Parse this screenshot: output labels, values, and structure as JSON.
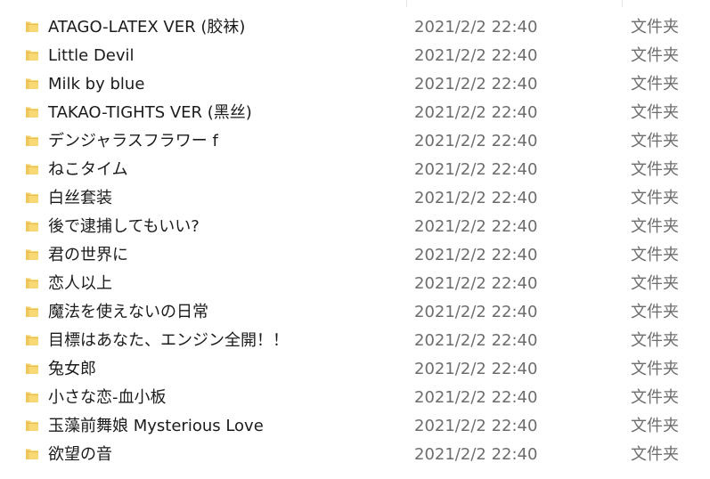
{
  "colors": {
    "folder_yellow": "#f8d775",
    "folder_dark": "#e8b84a",
    "name_text": "#1b1b1b",
    "meta_text": "#6d6d6d"
  },
  "files": [
    {
      "name": "ATAGO-LATEX VER (胶袜)",
      "date": "2021/2/2 22:40",
      "type": "文件夹",
      "icon": "folder-icon"
    },
    {
      "name": "Little Devil",
      "date": "2021/2/2 22:40",
      "type": "文件夹",
      "icon": "folder-icon"
    },
    {
      "name": "Milk by blue",
      "date": "2021/2/2 22:40",
      "type": "文件夹",
      "icon": "folder-icon"
    },
    {
      "name": "TAKAO-TIGHTS VER (黑丝)",
      "date": "2021/2/2 22:40",
      "type": "文件夹",
      "icon": "folder-icon"
    },
    {
      "name": "デンジャラスフラワー f",
      "date": "2021/2/2 22:40",
      "type": "文件夹",
      "icon": "folder-icon"
    },
    {
      "name": "ねこタイム",
      "date": "2021/2/2 22:40",
      "type": "文件夹",
      "icon": "folder-icon"
    },
    {
      "name": "白丝套装",
      "date": "2021/2/2 22:40",
      "type": "文件夹",
      "icon": "folder-icon"
    },
    {
      "name": "後で逮捕してもいい?",
      "date": "2021/2/2 22:40",
      "type": "文件夹",
      "icon": "folder-icon"
    },
    {
      "name": "君の世界に",
      "date": "2021/2/2 22:40",
      "type": "文件夹",
      "icon": "folder-icon"
    },
    {
      "name": "恋人以上",
      "date": "2021/2/2 22:40",
      "type": "文件夹",
      "icon": "folder-icon"
    },
    {
      "name": "魔法を使えないの日常",
      "date": "2021/2/2 22:40",
      "type": "文件夹",
      "icon": "folder-icon"
    },
    {
      "name": "目標はあなた、エンジン全開！！",
      "date": "2021/2/2 22:40",
      "type": "文件夹",
      "icon": "folder-icon"
    },
    {
      "name": "兔女郎",
      "date": "2021/2/2 22:40",
      "type": "文件夹",
      "icon": "folder-icon"
    },
    {
      "name": "小さな恋-血小板",
      "date": "2021/2/2 22:40",
      "type": "文件夹",
      "icon": "folder-icon"
    },
    {
      "name": "玉藻前舞娘 Mysterious Love",
      "date": "2021/2/2 22:40",
      "type": "文件夹",
      "icon": "folder-icon"
    },
    {
      "name": "欲望の音",
      "date": "2021/2/2 22:40",
      "type": "文件夹",
      "icon": "folder-icon"
    }
  ]
}
